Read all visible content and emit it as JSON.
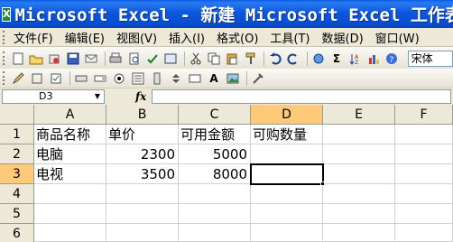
{
  "window": {
    "app_icon": "X",
    "title": "Microsoft Excel - 新建 Microsoft Excel 工作表"
  },
  "menu": {
    "items": [
      "文件(F)",
      "编辑(E)",
      "视图(V)",
      "插入(I)",
      "格式(O)",
      "工具(T)",
      "数据(D)",
      "窗口(W)"
    ]
  },
  "toolbar": {
    "font_name": "宋体",
    "icons1": [
      "new-icon",
      "open-icon",
      "permission-icon",
      "save-icon",
      "email-icon",
      "search-icon",
      "print-icon",
      "print-preview-icon",
      "spelling-icon",
      "research-icon",
      "cut-icon",
      "copy-icon",
      "paste-icon",
      "format-painter-icon",
      "undo-icon",
      "redo-icon",
      "hyperlink-icon",
      "autosum-icon",
      "sort-ascending-icon",
      "chart-wizard-icon",
      "help-icon"
    ],
    "icons2": [
      "pencil-icon",
      "border-icon",
      "erase-icon",
      "control-check-icon",
      "control-button-icon",
      "control-combo-icon",
      "control-radio-icon",
      "control-list-icon",
      "control-scroll-icon",
      "control-spin-icon",
      "control-text-icon",
      "text-a-icon",
      "image-icon",
      "properties-icon"
    ]
  },
  "formula_bar": {
    "name_box": "D3",
    "fx_label": "fx",
    "formula": ""
  },
  "sheet": {
    "columns": [
      "A",
      "B",
      "C",
      "D",
      "E",
      "F"
    ],
    "rows": [
      "1",
      "2",
      "3",
      "4",
      "5",
      "6"
    ],
    "active_column": "D",
    "active_row": "3",
    "cells": {
      "A1": "商品名称",
      "B1": "单价",
      "C1": "可用金额",
      "D1": "可购数量",
      "A2": "电脑",
      "B2": "2300",
      "C2": "5000",
      "A3": "电视",
      "B3": "3500",
      "C3": "8000"
    }
  }
}
